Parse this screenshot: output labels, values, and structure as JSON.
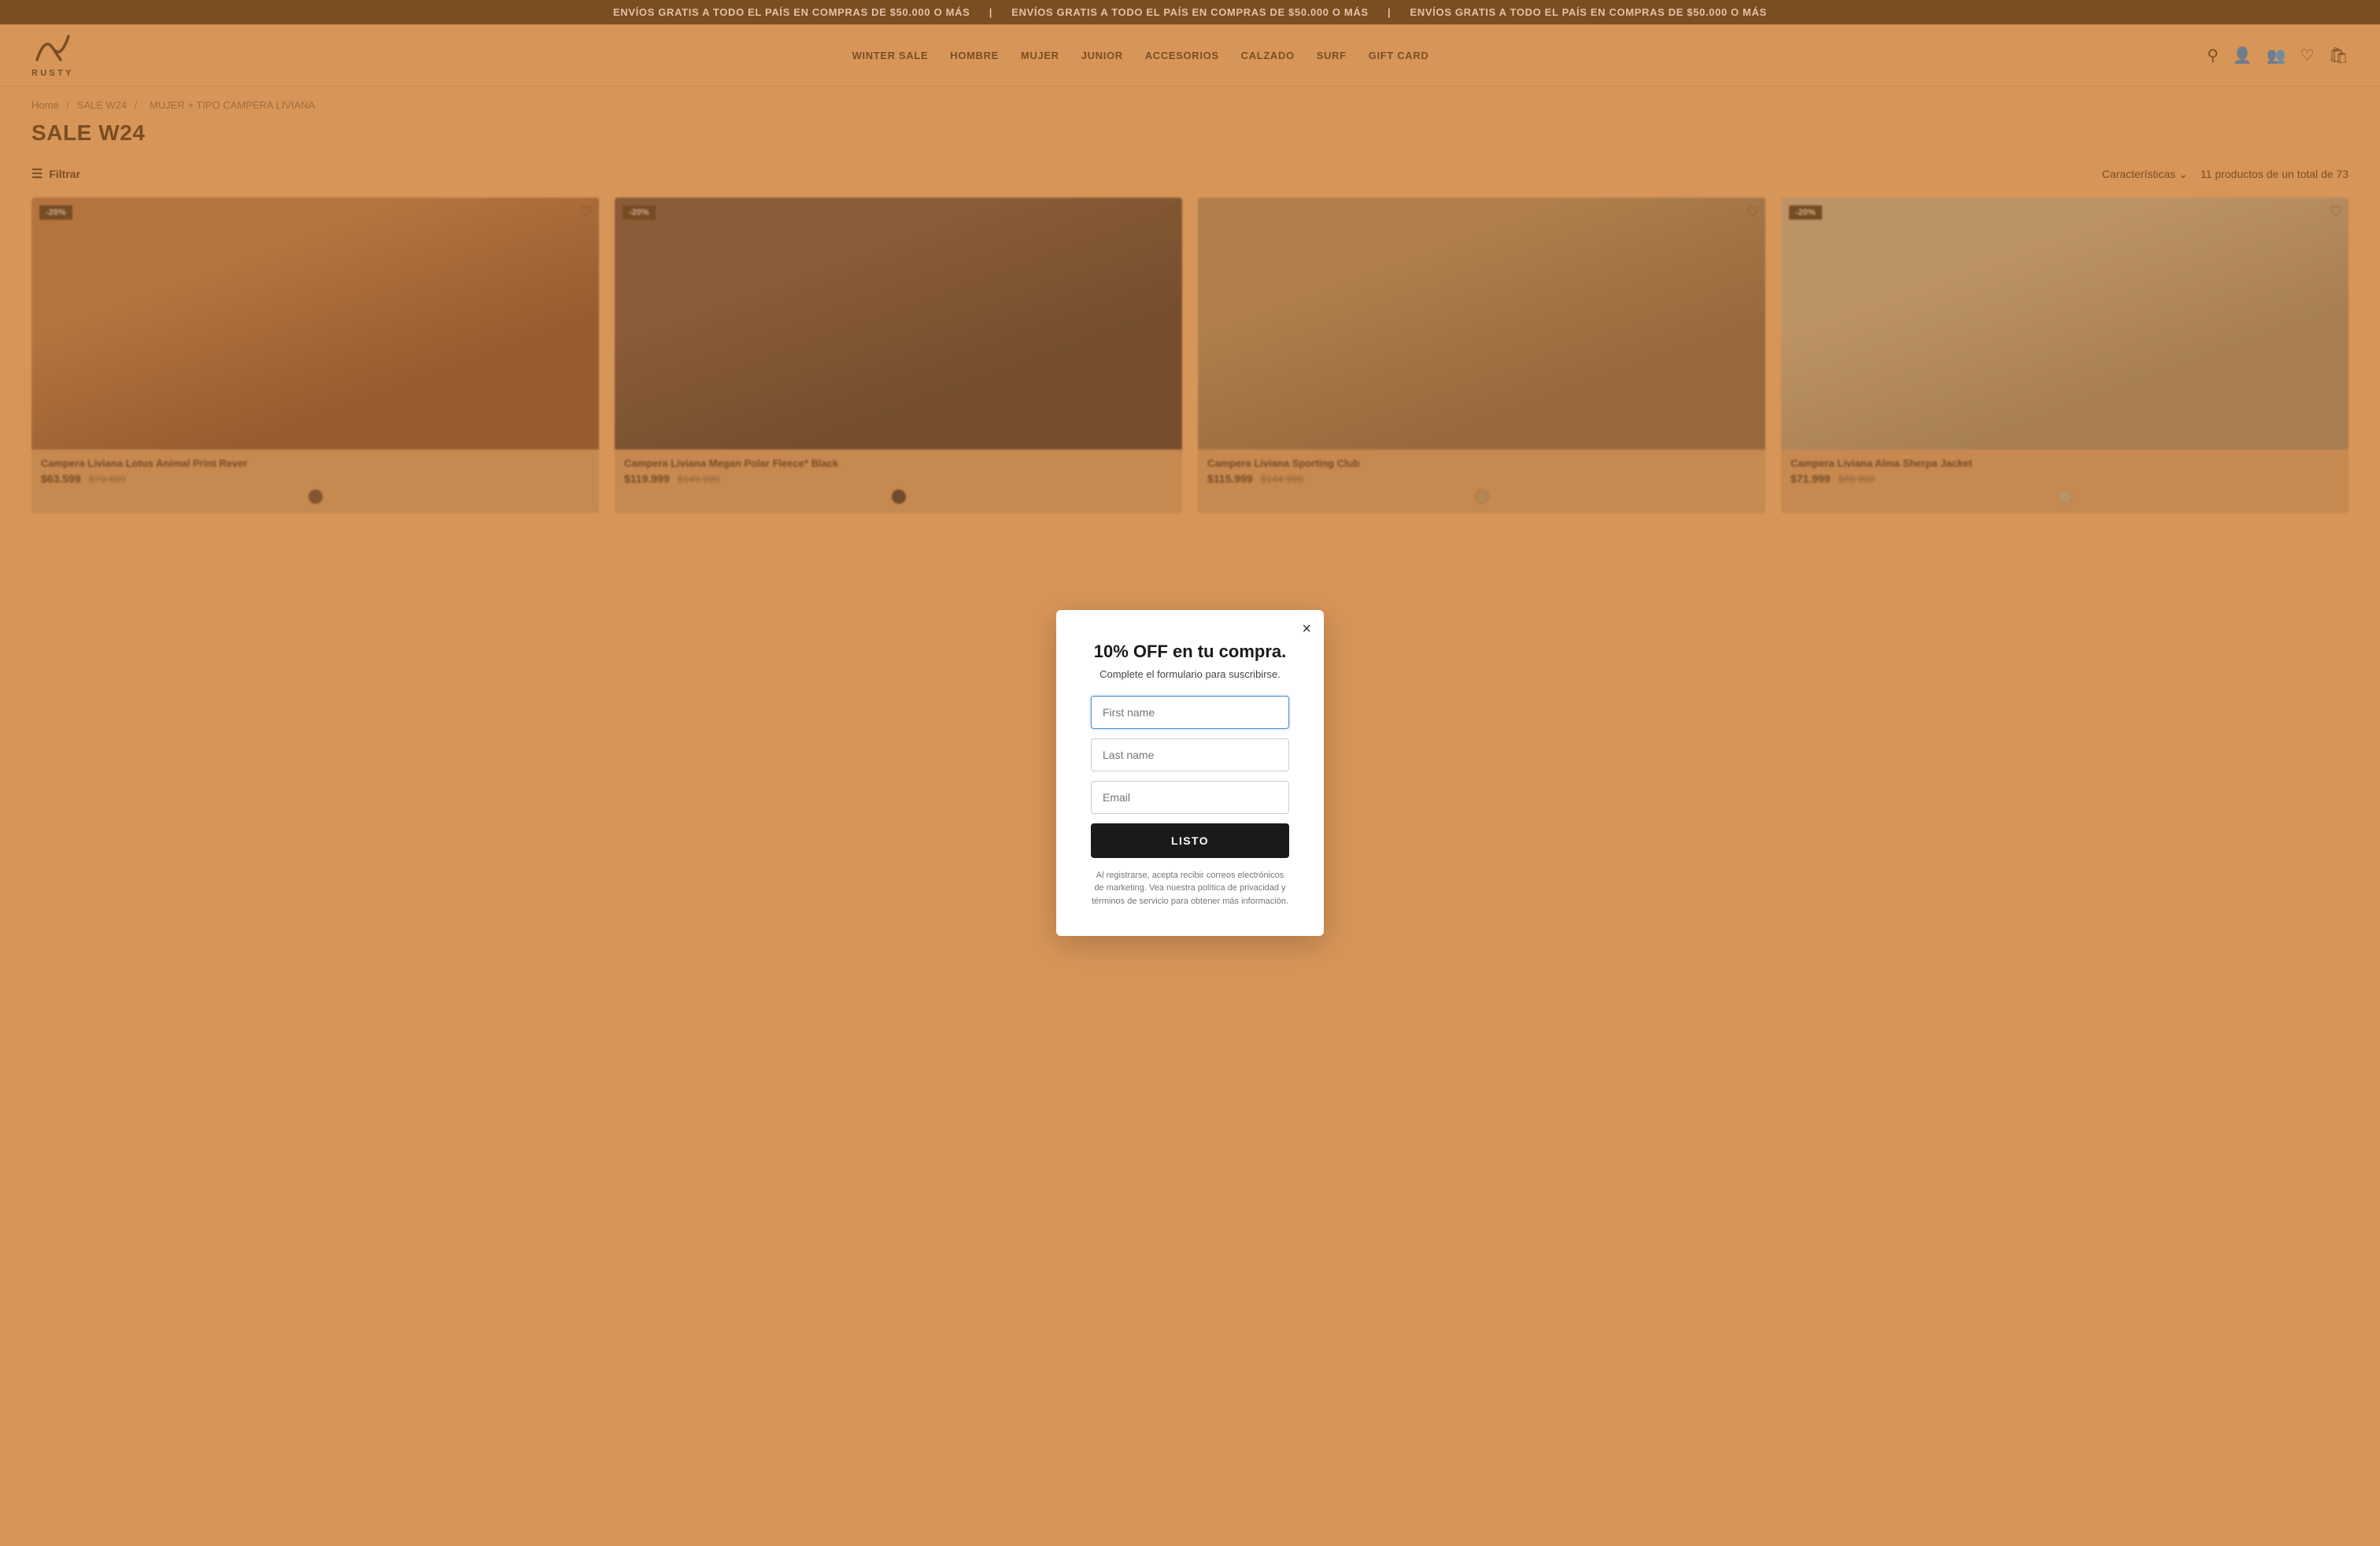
{
  "topBanner": {
    "text": "ENVÍOS GRATIS A TODO EL PAÍS EN COMPRAS DE $50.000 O MÁS"
  },
  "header": {
    "logoText": "RUSTY",
    "nav": [
      {
        "label": "WINTER SALE",
        "id": "winter-sale"
      },
      {
        "label": "HOMBRE",
        "id": "hombre"
      },
      {
        "label": "MUJER",
        "id": "mujer"
      },
      {
        "label": "JUNIOR",
        "id": "junior"
      },
      {
        "label": "ACCESORIOS",
        "id": "accesorios"
      },
      {
        "label": "CALZADO",
        "id": "calzado"
      },
      {
        "label": "SURF",
        "id": "surf"
      },
      {
        "label": "GIFT CARD",
        "id": "gift-card"
      }
    ]
  },
  "breadcrumb": {
    "items": [
      "Home",
      "SALE W24",
      "MUJER + TIPO CAMPERA LIVIANA"
    ]
  },
  "pageTitle": "SALE W24",
  "filterBar": {
    "filterLabel": "Filtrar",
    "sortLabel": "Características",
    "productCount": "11 productos de un total de 73"
  },
  "products": [
    {
      "name": "Campera Liviana Lotus Animal Print Rever",
      "currentPrice": "$63.599",
      "originalPrice": "$79.490",
      "badge": "-20%",
      "color1": "#4a3020",
      "color2": "#8a6040"
    },
    {
      "name": "Campera Liviana Megan Polar Fleece* Black",
      "currentPrice": "$119.999",
      "originalPrice": "$149.990",
      "badge": "-20%",
      "color1": "#1a1a1a",
      "color2": "#555555"
    },
    {
      "name": "Campera Liviana Sporting Club",
      "currentPrice": "$115.999",
      "originalPrice": "$144.990",
      "badge": null,
      "color1": "#c0a070",
      "color2": "#8a6040"
    },
    {
      "name": "Campera Liviana Alma Sherpa Jacket",
      "currentPrice": "$71.999",
      "originalPrice": "$89.990",
      "badge": "-20%",
      "color1": "#d0c0a0",
      "color2": "#a09070"
    }
  ],
  "modal": {
    "title": "10% OFF en tu compra.",
    "subtitle": "Complete el formulario para suscribirse.",
    "firstNamePlaceholder": "First name",
    "lastNamePlaceholder": "Last name",
    "emailPlaceholder": "Email",
    "submitLabel": "LISTO",
    "disclaimer": "Al registrarse, acepta recibir correos electrónicos de marketing. Vea nuestra política de privacidad y términos de servicio para obtener más información.",
    "closeLabel": "×"
  }
}
